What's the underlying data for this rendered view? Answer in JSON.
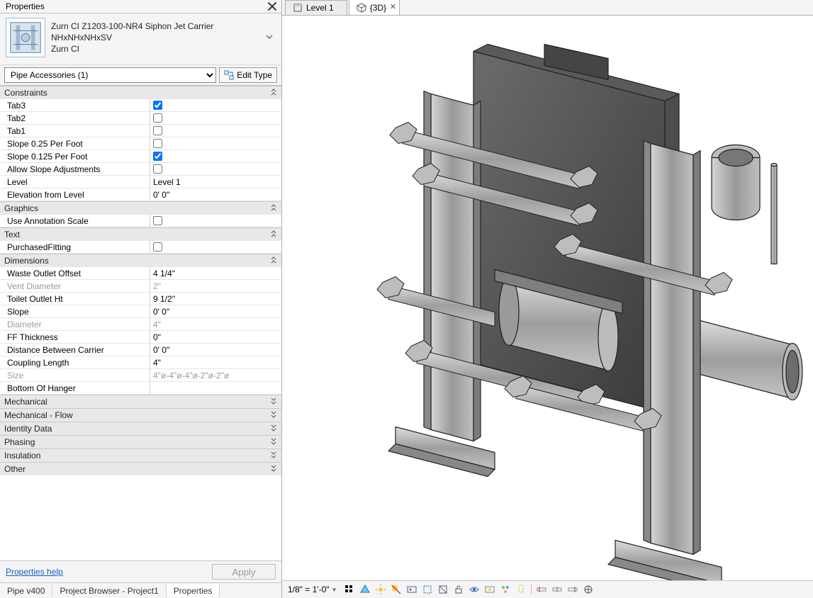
{
  "panel": {
    "title": "Properties",
    "family": {
      "name": "Zurn CI Z1203-100-NR4 Siphon Jet Carrier",
      "type": "NHxNHxNHxSV",
      "mfr": "Zurn CI"
    },
    "selector_label": "Pipe Accessories (1)",
    "edit_type_label": "Edit Type",
    "groups": [
      {
        "title": "Constraints",
        "expanded": true,
        "rows": [
          {
            "name": "Tab3",
            "kind": "check",
            "checked": true
          },
          {
            "name": "Tab2",
            "kind": "check",
            "checked": false
          },
          {
            "name": "Tab1",
            "kind": "check",
            "checked": false
          },
          {
            "name": "Slope 0.25 Per Foot",
            "kind": "check",
            "checked": false
          },
          {
            "name": "Slope 0.125 Per Foot",
            "kind": "check",
            "checked": true
          },
          {
            "name": "Allow Slope Adjustments",
            "kind": "check",
            "checked": false
          },
          {
            "name": "Level",
            "kind": "text",
            "value": "Level 1"
          },
          {
            "name": "Elevation from Level",
            "kind": "text",
            "value": "0'  0\""
          }
        ]
      },
      {
        "title": "Graphics",
        "expanded": true,
        "rows": [
          {
            "name": "Use Annotation Scale",
            "kind": "check",
            "checked": false
          }
        ]
      },
      {
        "title": "Text",
        "expanded": true,
        "rows": [
          {
            "name": "PurchasedFitting",
            "kind": "check",
            "checked": false
          }
        ]
      },
      {
        "title": "Dimensions",
        "expanded": true,
        "rows": [
          {
            "name": "Waste Outlet Offset",
            "kind": "text",
            "value": "4 1/4\""
          },
          {
            "name": "Vent Diameter",
            "kind": "text",
            "value": "2\"",
            "disabled": true
          },
          {
            "name": "Toilet Outlet Ht",
            "kind": "text",
            "value": "9 1/2\""
          },
          {
            "name": "Slope",
            "kind": "text",
            "value": "0'  0\""
          },
          {
            "name": "Diameter",
            "kind": "text",
            "value": "4\"",
            "disabled": true
          },
          {
            "name": "FF Thickness",
            "kind": "text",
            "value": "0\""
          },
          {
            "name": "Distance Between Carrier",
            "kind": "text",
            "value": "0'  0\""
          },
          {
            "name": "Coupling Length",
            "kind": "text",
            "value": "4\""
          },
          {
            "name": "Size",
            "kind": "text",
            "value": "4\"ø-4\"ø-4\"ø-2\"ø-2\"ø",
            "disabled": true
          },
          {
            "name": "Bottom Of Hanger",
            "kind": "text",
            "value": ""
          }
        ]
      },
      {
        "title": "Mechanical",
        "expanded": false
      },
      {
        "title": "Mechanical - Flow",
        "expanded": false
      },
      {
        "title": "Identity Data",
        "expanded": false
      },
      {
        "title": "Phasing",
        "expanded": false
      },
      {
        "title": "Insulation",
        "expanded": false
      },
      {
        "title": "Other",
        "expanded": false
      }
    ],
    "help_label": "Properties help",
    "apply_label": "Apply",
    "bottom_tabs": [
      "Pipe v400",
      "Project Browser - Project1",
      "Properties"
    ],
    "bottom_active_idx": 2
  },
  "view": {
    "tabs": [
      {
        "label": "Level 1",
        "icon": "plan-icon",
        "active": false,
        "closable": false
      },
      {
        "label": "{3D}",
        "icon": "cube-icon",
        "active": true,
        "closable": true
      }
    ],
    "scale": "1/8\" = 1'-0\"",
    "toolbar_icons": [
      "detail-level-icon",
      "visual-style-icon",
      "sun-path-icon",
      "shadows-icon",
      "render-icon",
      "crop-region-icon",
      "crop-visible-icon",
      "unlock-icon",
      "temporary-hide-icon",
      "reveal-hidden-icon",
      "worksharing-icon",
      "lightbulb-icon",
      "separator",
      "constraints1-icon",
      "constraints2-icon",
      "constraints3-icon",
      "nav-icon"
    ]
  }
}
